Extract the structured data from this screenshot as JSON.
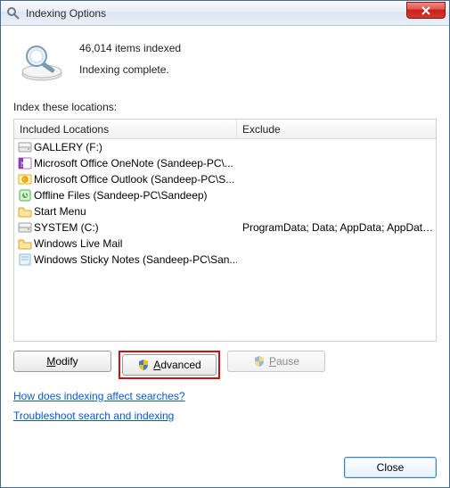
{
  "window": {
    "title": "Indexing Options"
  },
  "status": {
    "count_text": "46,014 items indexed",
    "state_text": "Indexing complete."
  },
  "section_label": "Index these locations:",
  "columns": {
    "included": "Included Locations",
    "exclude": "Exclude"
  },
  "rows": [
    {
      "icon": "drive",
      "name": "GALLERY (F:)",
      "exclude": ""
    },
    {
      "icon": "onenote",
      "name": "Microsoft Office OneNote (Sandeep-PC\\...",
      "exclude": ""
    },
    {
      "icon": "outlook",
      "name": "Microsoft Office Outlook (Sandeep-PC\\S...",
      "exclude": ""
    },
    {
      "icon": "offline",
      "name": "Offline Files (Sandeep-PC\\Sandeep)",
      "exclude": ""
    },
    {
      "icon": "folder",
      "name": "Start Menu",
      "exclude": ""
    },
    {
      "icon": "drive",
      "name": "SYSTEM (C:)",
      "exclude": "ProgramData; Data; AppData; AppData; ..."
    },
    {
      "icon": "folder",
      "name": "Windows Live Mail",
      "exclude": ""
    },
    {
      "icon": "sticky",
      "name": "Windows Sticky Notes (Sandeep-PC\\San...",
      "exclude": ""
    }
  ],
  "buttons": {
    "modify": "Modify",
    "advanced": "Advanced",
    "pause": "Pause",
    "close": "Close"
  },
  "links": {
    "how": "How does indexing affect searches?",
    "troubleshoot": "Troubleshoot search and indexing"
  }
}
